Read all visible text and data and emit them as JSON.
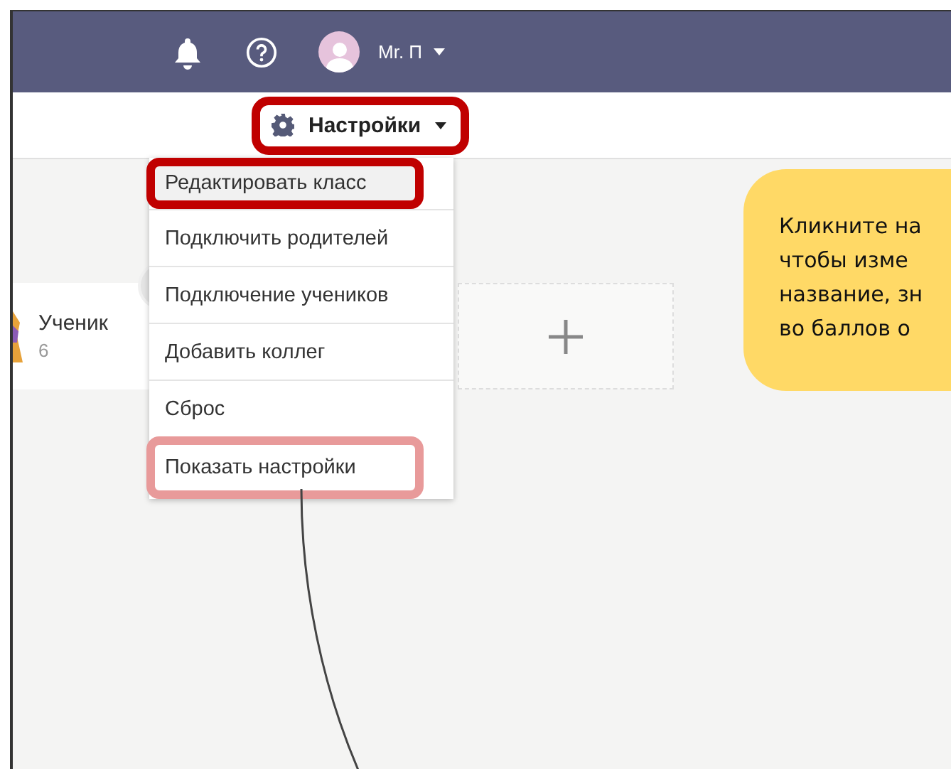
{
  "header": {
    "user_name": "Mr. П"
  },
  "toolbar": {
    "settings_button": {
      "label": "Настройки",
      "highlighted": true
    }
  },
  "settings_menu": {
    "items": [
      {
        "label": "Редактировать класс",
        "highlighted": true,
        "color": "#c00000"
      },
      {
        "label": "Подключить родителей",
        "highlighted": false
      },
      {
        "label": "Подключение учеников",
        "highlighted": false
      },
      {
        "label": "Добавить коллег",
        "highlighted": false
      },
      {
        "label": "Сброс",
        "highlighted": false
      },
      {
        "label": "Показать настройки",
        "highlighted": true,
        "color": "#e89a9a"
      }
    ]
  },
  "student_card": {
    "name": "Ученик",
    "points": "6"
  },
  "callout": {
    "lines": [
      "Кликните на",
      "чтобы изме",
      "название, зн",
      "во баллов о"
    ]
  }
}
